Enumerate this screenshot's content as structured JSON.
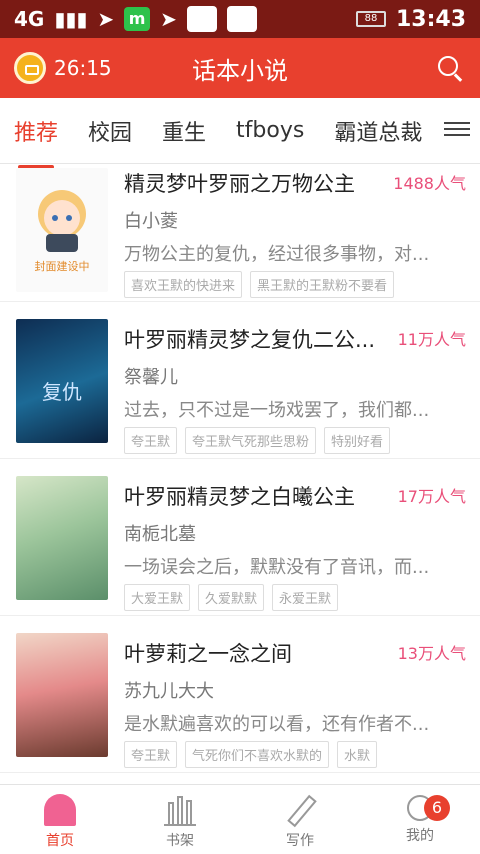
{
  "status_bar": {
    "network": "4G",
    "battery": "88",
    "time": "13:43",
    "wechat_label": "m"
  },
  "app_bar": {
    "timer": "26:15",
    "title": "话本小说"
  },
  "tabs": [
    "推荐",
    "校园",
    "重生",
    "tfboys",
    "霸道总裁"
  ],
  "books": [
    {
      "title": "精灵梦叶罗丽之万物公主",
      "popularity": "1488人气",
      "author": "白小菱",
      "desc": "万物公主的复仇，经过很多事物，对...",
      "cover_text": "封面建设中",
      "tags": [
        "喜欢王默的快进来",
        "黑王默的王默粉不要看"
      ]
    },
    {
      "title": "叶罗丽精灵梦之复仇二公...",
      "popularity": "11万人气",
      "author": "祭馨儿",
      "desc": "过去，只不过是一场戏罢了，我们都...",
      "cover_text": "复仇",
      "tags": [
        "夸王默",
        "夸王默气死那些思粉",
        "特别好看"
      ]
    },
    {
      "title": "叶罗丽精灵梦之白曦公主",
      "popularity": "17万人气",
      "author": "南栀北墓",
      "desc": "一场误会之后，默默没有了音讯，而...",
      "cover_text": "",
      "tags": [
        "大爱王默",
        "久爱默默",
        "永爱王默"
      ]
    },
    {
      "title": "叶萝莉之一念之间",
      "popularity": "13万人气",
      "author": "苏九儿大大",
      "desc": "是水默遍喜欢的可以看，还有作者不...",
      "cover_text": "",
      "tags": [
        "夸王默",
        "气死你们不喜欢水默的",
        "水默"
      ]
    }
  ],
  "bottom_nav": {
    "home": "首页",
    "shelf": "书架",
    "write": "写作",
    "me": "我的",
    "me_badge": "6"
  }
}
